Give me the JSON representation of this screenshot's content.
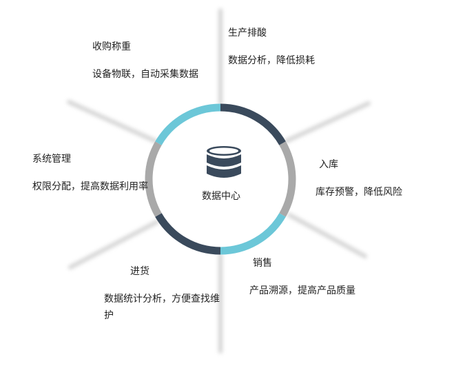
{
  "center": {
    "label": "数据中心",
    "icon": "database-icon"
  },
  "ring_colors": {
    "accent": "#6cc7d8",
    "dark": "#3a4a5c",
    "gray": "#a9a9a9"
  },
  "sections": [
    {
      "id": "production",
      "title": "生产排酸",
      "desc": "数据分析，降低损耗"
    },
    {
      "id": "storage",
      "title": "入库",
      "desc": "库存预警，降低风险"
    },
    {
      "id": "sales",
      "title": "销售",
      "desc": "产品溯源，提高产品质量"
    },
    {
      "id": "purchase",
      "title": "进货",
      "desc": "数据统计分析，方便查找维护"
    },
    {
      "id": "system",
      "title": "系统管理",
      "desc": "权限分配，提高数据利用率"
    },
    {
      "id": "weighing",
      "title": "收购称重",
      "desc": "设备物联，自动采集数据"
    }
  ]
}
